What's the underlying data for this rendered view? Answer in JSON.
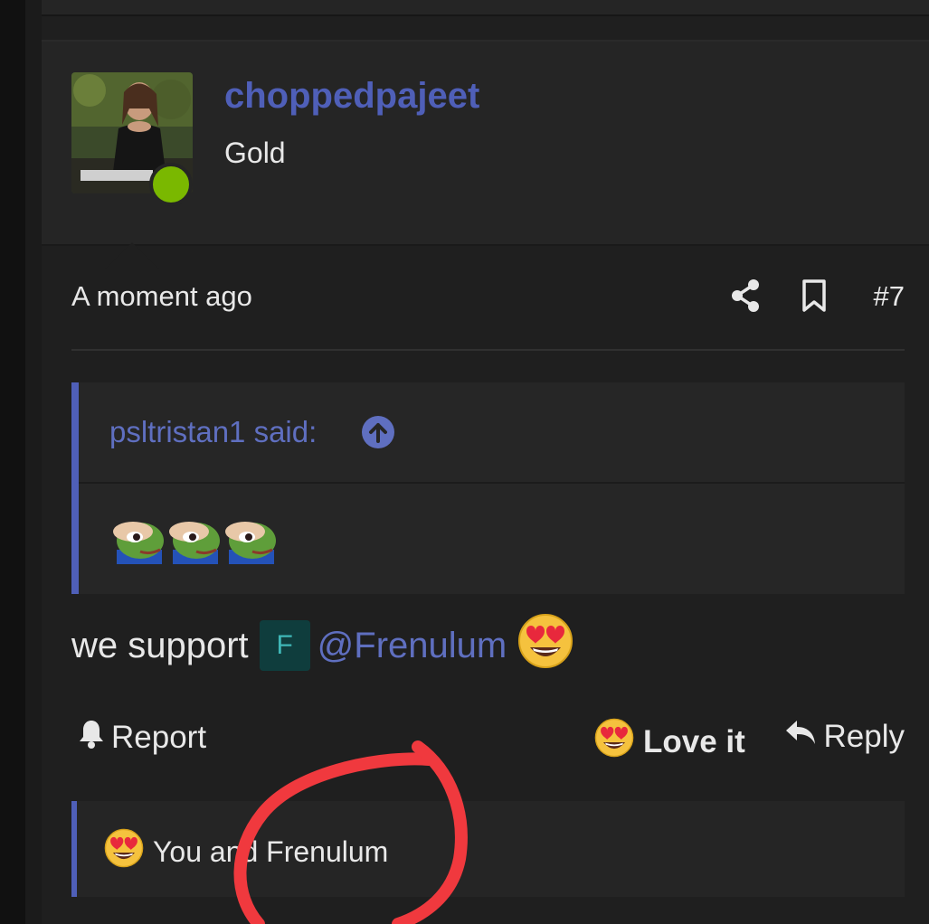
{
  "user": {
    "username": "choppedpajeet",
    "title": "Gold"
  },
  "post": {
    "timestamp": "A moment ago",
    "number": "#7"
  },
  "quote": {
    "attribution": "psltristan1 said:",
    "content_icons": [
      "pepe-emoji",
      "pepe-emoji",
      "pepe-emoji"
    ]
  },
  "message": {
    "text": "we support",
    "mention_initial": "F",
    "mention": "@Frenulum"
  },
  "actions": {
    "report_label": "Report",
    "love_label": "Love it",
    "reply_label": "Reply"
  },
  "reactions": {
    "text": "You and Frenulum"
  },
  "icons": [
    "share-icon",
    "bookmark-icon",
    "arrow-up-circle-icon",
    "bell-icon",
    "reply-icon",
    "heart-eyes-emoji"
  ],
  "colors": {
    "accent": "#4f5fb8",
    "online": "#7ab800",
    "scribble": "#f0393e",
    "background": "#1f1f1f"
  }
}
